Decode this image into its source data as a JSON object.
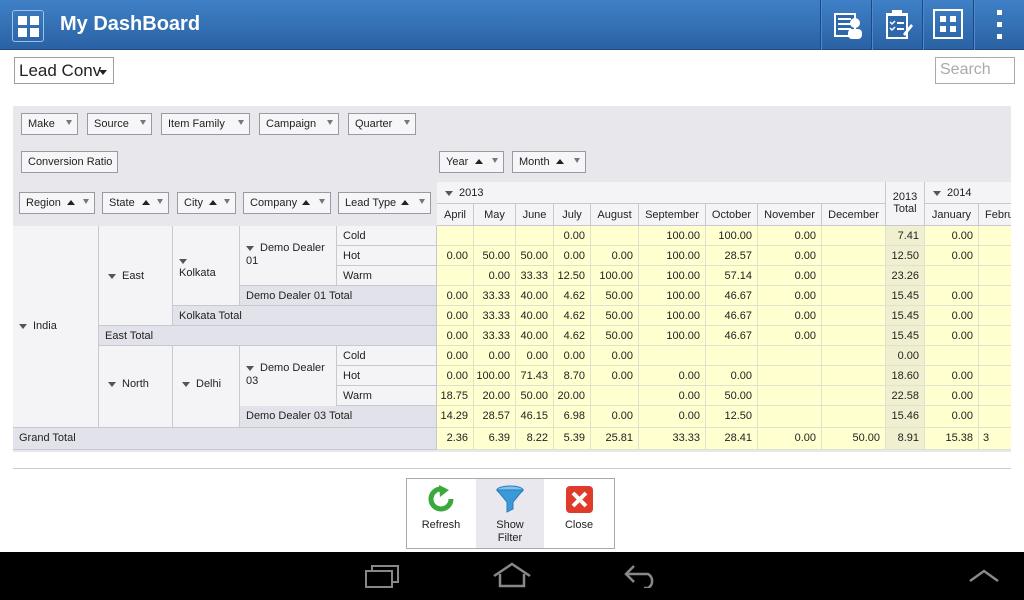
{
  "header": {
    "title": "My DashBoard",
    "icons": [
      "apps-grid-icon",
      "report-icon",
      "clipboard-icon",
      "dashboard-grid-icon",
      "overflow-menu-icon"
    ]
  },
  "controls": {
    "selected_report": "Lead Conv",
    "search_placeholder": "Search"
  },
  "pivot": {
    "filter_fields": [
      "Make",
      "Source",
      "Item Family",
      "Campaign",
      "Quarter"
    ],
    "data_field": "Conversion Ratio",
    "column_fields": [
      "Year",
      "Month"
    ],
    "row_fields": [
      "Region",
      "State",
      "City",
      "Company",
      "Lead Type"
    ],
    "years": [
      "2013",
      "2014"
    ],
    "year_total": "2013 Total",
    "months": [
      "April",
      "May",
      "June",
      "July",
      "August",
      "September",
      "October",
      "November",
      "December",
      "January",
      "Febru"
    ],
    "labels": {
      "india": "India",
      "east": "East",
      "north": "North",
      "kolkata": "Kolkata",
      "delhi": "Delhi",
      "dd01": "Demo Dealer 01",
      "dd03": "Demo Dealer 03",
      "cold": "Cold",
      "hot": "Hot",
      "warm": "Warm",
      "cold2": "Cold",
      "hot2": "Hot",
      "warm2": "Warm",
      "dd01_total": "Demo Dealer 01 Total",
      "kolkata_total": "Kolkata Total",
      "east_total": "East Total",
      "dd03_total": "Demo Dealer 03 Total",
      "grand_total": "Grand Total"
    },
    "rows": [
      [
        "",
        "",
        "",
        "0.00",
        "",
        "100.00",
        "100.00",
        "0.00",
        "",
        "7.41",
        "0.00",
        ""
      ],
      [
        "0.00",
        "50.00",
        "50.00",
        "0.00",
        "0.00",
        "100.00",
        "28.57",
        "0.00",
        "",
        "12.50",
        "0.00",
        ""
      ],
      [
        "",
        "0.00",
        "33.33",
        "12.50",
        "100.00",
        "100.00",
        "57.14",
        "0.00",
        "",
        "23.26",
        "",
        ""
      ],
      [
        "0.00",
        "33.33",
        "40.00",
        "4.62",
        "50.00",
        "100.00",
        "46.67",
        "0.00",
        "",
        "15.45",
        "0.00",
        ""
      ],
      [
        "0.00",
        "33.33",
        "40.00",
        "4.62",
        "50.00",
        "100.00",
        "46.67",
        "0.00",
        "",
        "15.45",
        "0.00",
        ""
      ],
      [
        "0.00",
        "33.33",
        "40.00",
        "4.62",
        "50.00",
        "100.00",
        "46.67",
        "0.00",
        "",
        "15.45",
        "0.00",
        ""
      ],
      [
        "0.00",
        "0.00",
        "0.00",
        "0.00",
        "0.00",
        "",
        "",
        "",
        "",
        "0.00",
        "",
        ""
      ],
      [
        "0.00",
        "100.00",
        "71.43",
        "8.70",
        "0.00",
        "0.00",
        "0.00",
        "",
        "",
        "18.60",
        "0.00",
        ""
      ],
      [
        "18.75",
        "20.00",
        "50.00",
        "20.00",
        "",
        "0.00",
        "50.00",
        "",
        "",
        "22.58",
        "0.00",
        ""
      ],
      [
        "14.29",
        "28.57",
        "46.15",
        "6.98",
        "0.00",
        "0.00",
        "12.50",
        "",
        "",
        "15.46",
        "0.00",
        ""
      ],
      [
        "2.36",
        "6.39",
        "8.22",
        "5.39",
        "25.81",
        "33.33",
        "28.41",
        "0.00",
        "50.00",
        "8.91",
        "15.38",
        "3"
      ]
    ]
  },
  "toolbar": {
    "refresh": "Refresh",
    "show_filter_1": "Show",
    "show_filter_2": "Filter",
    "close": "Close"
  },
  "colors": {
    "header_blue": "#2f6db3",
    "data_cell": "#ffffd0",
    "close_red": "#e03a2a",
    "refresh_green": "#3aa83a",
    "filter_blue": "#3a9ad8"
  }
}
